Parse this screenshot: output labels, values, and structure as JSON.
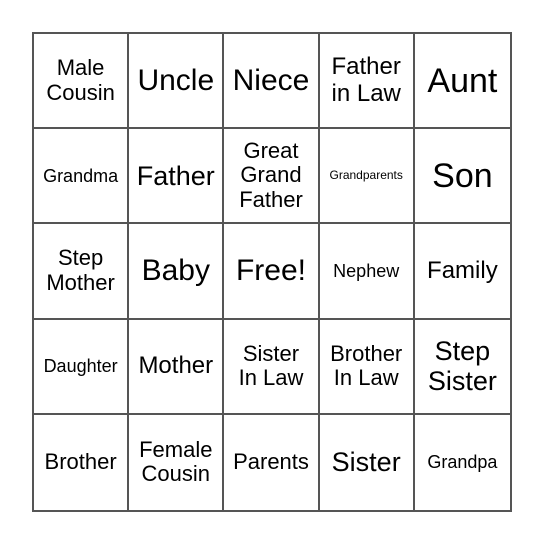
{
  "card": {
    "cells": [
      [
        "Male\nCousin",
        "Uncle",
        "Niece",
        "Father\nin Law",
        "Aunt"
      ],
      [
        "Grandma",
        "Father",
        "Great\nGrand\nFather",
        "Grandparents",
        "Son"
      ],
      [
        "Step\nMother",
        "Baby",
        "Free!",
        "Nephew",
        "Family"
      ],
      [
        "Daughter",
        "Mother",
        "Sister\nIn Law",
        "Brother\nIn Law",
        "Step\nSister"
      ],
      [
        "Brother",
        "Female\nCousin",
        "Parents",
        "Sister",
        "Grandpa"
      ]
    ]
  }
}
